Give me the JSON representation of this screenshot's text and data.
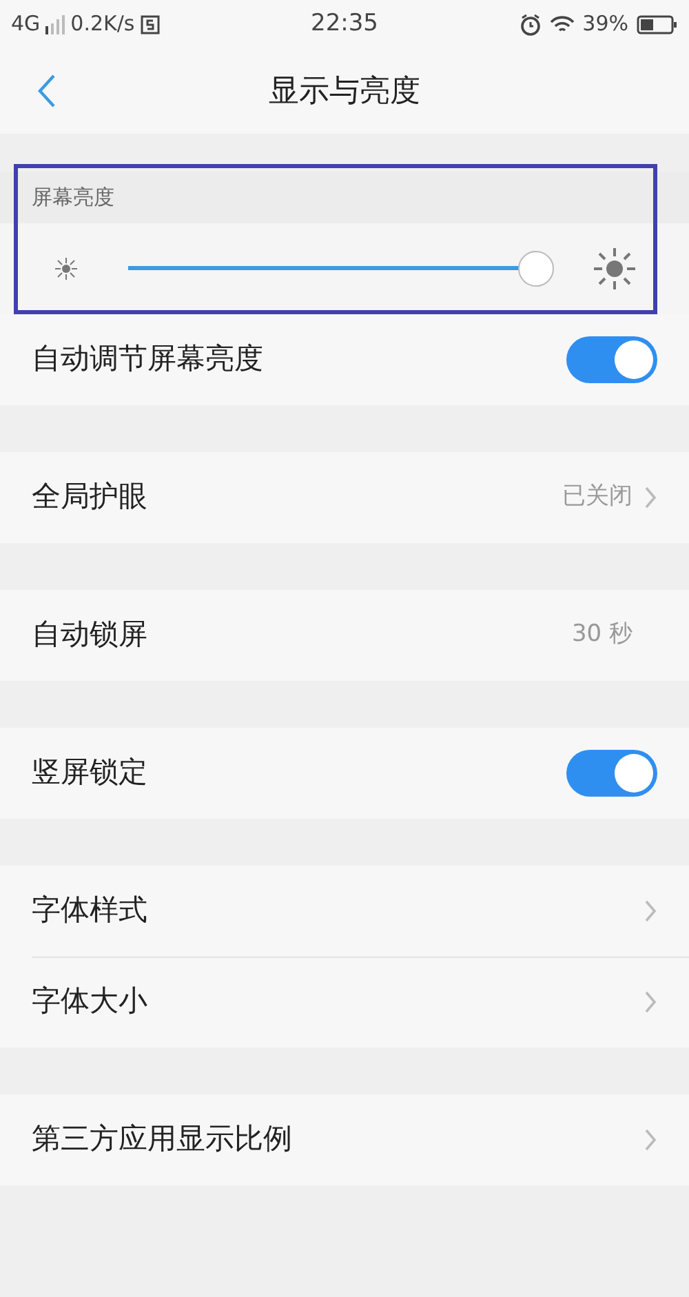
{
  "status_bar": {
    "network": "4G",
    "speed": "0.2K/s",
    "time": "22:35",
    "battery": "39%"
  },
  "header": {
    "title": "显示与亮度"
  },
  "brightness": {
    "label": "屏幕亮度",
    "level": 1
  },
  "groups": [
    [
      {
        "kind": "toggle",
        "label": "自动调节屏幕亮度",
        "on": true
      }
    ],
    [
      {
        "kind": "value",
        "label": "全局护眼",
        "value": "已关闭",
        "chevron": true
      }
    ],
    [
      {
        "kind": "value",
        "label": "自动锁屏",
        "value": "30 秒",
        "chevron": false
      }
    ],
    [
      {
        "kind": "toggle",
        "label": "竖屏锁定",
        "on": true
      }
    ],
    [
      {
        "kind": "link",
        "label": "字体样式"
      },
      {
        "kind": "link",
        "label": "字体大小"
      }
    ],
    [
      {
        "kind": "link",
        "label": "第三方应用显示比例"
      }
    ]
  ]
}
